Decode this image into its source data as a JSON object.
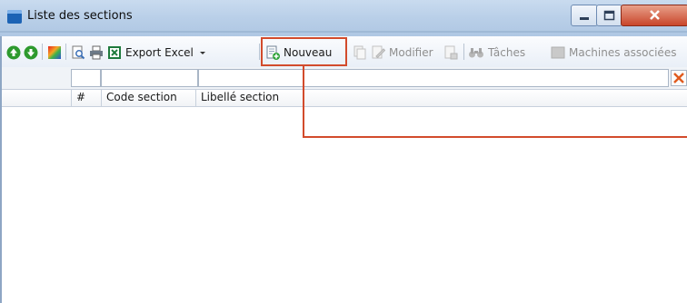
{
  "window": {
    "title": "Liste des sections"
  },
  "toolbar": {
    "export_excel": "Export Excel",
    "nouveau": "Nouveau",
    "modifier": "Modifier",
    "taches": "Tâches",
    "machines": "Machines associées"
  },
  "grid": {
    "columns": [
      "#",
      "Code section",
      "Libellé section"
    ],
    "rows": []
  },
  "colors": {
    "highlight": "#d24b2c",
    "title_icon": "#1c63b5"
  }
}
